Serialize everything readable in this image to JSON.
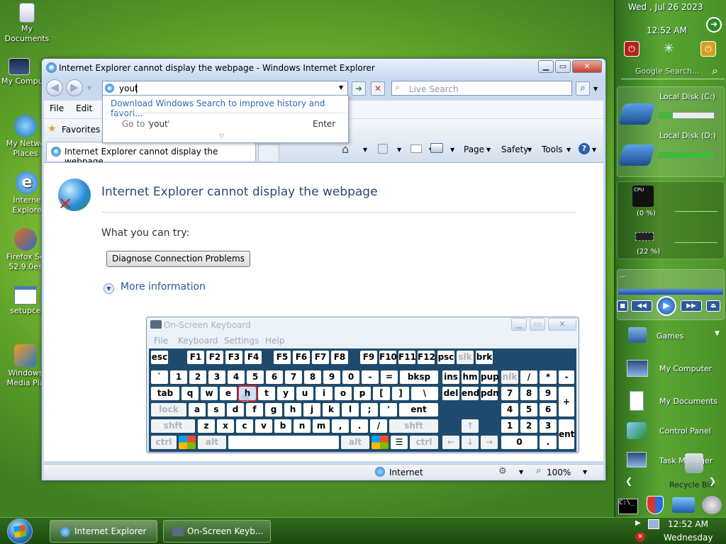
{
  "desktop_icons": [
    {
      "label": "My Documents",
      "icon": "folder-documents-icon"
    },
    {
      "label": "My Compu",
      "icon": "computer-icon"
    },
    {
      "label": "My Netwo Places",
      "icon": "network-icon"
    },
    {
      "label": "Interne Explore",
      "icon": "ie-icon"
    },
    {
      "label": "Firefox Se 52.9.0es",
      "icon": "firefox-setup-icon"
    },
    {
      "label": "setupce",
      "icon": "setup-icon"
    },
    {
      "label": "Windows Media Pla",
      "icon": "media-player-icon"
    }
  ],
  "sidebar": {
    "date": "Wed , Jul 26 2023",
    "time": "12:52 AM",
    "search_placeholder": "Google Search...",
    "disks": [
      {
        "label": "Local Disk (C:)",
        "usage": 0.25
      },
      {
        "label": "Local Disk (D:)",
        "usage": 1.0
      }
    ],
    "cpu_label": "CPU",
    "cpu_value": "(0 %)",
    "mem_value": "(22 %)",
    "player_dash": "--",
    "shortcuts": [
      "Games",
      "My Computer",
      "My Documents",
      "Control Panel",
      "Task Manager"
    ],
    "recycle_bin": "Recycle Bin"
  },
  "ie": {
    "title": "Internet Explorer cannot display the webpage - Windows Internet Explorer",
    "address_value": "yout",
    "search_placeholder": "Live Search",
    "menu": [
      "File",
      "Edit"
    ],
    "favorites": "Favorites",
    "tab_title": "Internet Explorer cannot display the webpage",
    "toolbar": {
      "page": "Page",
      "safety": "Safety",
      "tools": "Tools"
    },
    "dropdown": {
      "link": "Download Windows Search to improve history and favori...",
      "goto_prefix": "Go to '",
      "goto_term": "yout",
      "goto_suffix": "'",
      "goto_key": "Enter"
    },
    "content": {
      "heading": "Internet Explorer cannot display the webpage",
      "try_label": "What you can try:",
      "diagnose_button": "Diagnose Connection Problems",
      "more_info": "More information"
    },
    "status": {
      "zone": "Internet",
      "zoom": "100%"
    }
  },
  "osk": {
    "title": "On-Screen Keyboard",
    "menu": [
      "File",
      "Keyboard",
      "Settings",
      "Help"
    ]
  },
  "taskbar": {
    "tasks": [
      "Internet Explorer ...",
      "On-Screen Keyb..."
    ],
    "clock_time": "12:52 AM",
    "clock_day": "Wednesday"
  }
}
